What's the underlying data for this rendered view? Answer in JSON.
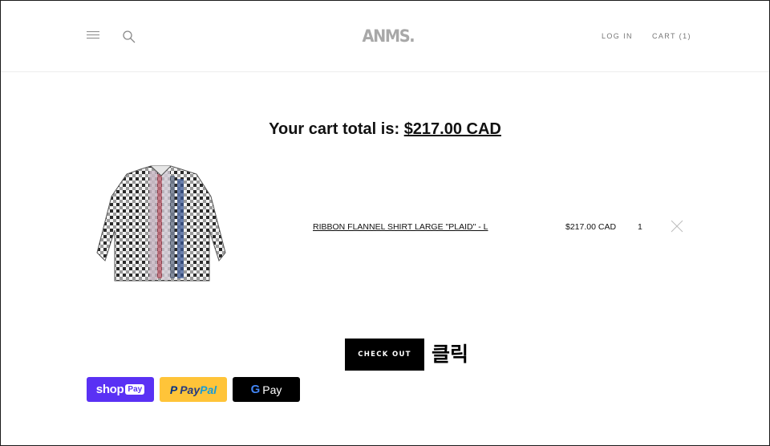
{
  "header": {
    "logo": "ANMS.",
    "login_label": "LOG IN",
    "cart_label": "CART (1)"
  },
  "cart": {
    "title_prefix": "Your cart total is:",
    "total": "$217.00 CAD",
    "items": [
      {
        "name": "RIBBON FLANNEL SHIRT LARGE \"PLAID\" - L",
        "price": "$217.00 CAD",
        "quantity": "1"
      }
    ],
    "checkout_label": "CHECK OUT",
    "annotation": "클릭"
  },
  "payments": {
    "shoppay": {
      "shop": "shop",
      "pay": "Pay",
      "color": "#5a31f4"
    },
    "paypal": {
      "pay1": "Pay",
      "pay2": "Pal",
      "color": "#ffc439"
    },
    "gpay": {
      "g": "G",
      "pay": "Pay",
      "color": "#000000"
    }
  },
  "icons": [
    "menu-icon",
    "search-icon",
    "close-icon"
  ]
}
